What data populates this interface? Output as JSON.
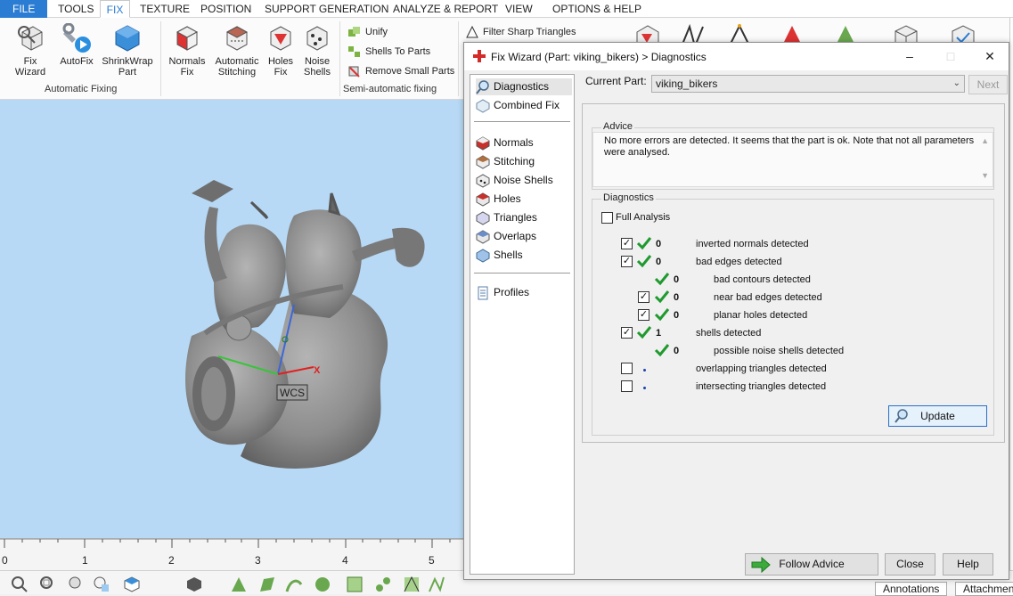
{
  "ribbon_tabs": [
    "FILE",
    "TOOLS",
    "FIX",
    "TEXTURE",
    "POSITION",
    "SUPPORT GENERATION",
    "ANALYZE & REPORT",
    "VIEW",
    "OPTIONS & HELP"
  ],
  "ribbon": {
    "auto_group": {
      "label": "Automatic Fixing",
      "buttons": [
        "Fix Wizard",
        "AutoFix",
        "ShrinkWrap Part"
      ]
    },
    "semi_group": {
      "label": "Semi-automatic fixing",
      "buttons": [
        "Normals Fix",
        "Automatic Stitching",
        "Holes Fix",
        "Noise Shells"
      ],
      "small_buttons": [
        "Unify",
        "Shells To Parts",
        "Remove Small Parts"
      ]
    },
    "filter_label": "Filter Sharp Triangles"
  },
  "viewport": {
    "wcs_label": "WCS",
    "axis_x_label": "X",
    "ruler_ticks": [
      "0",
      "1",
      "2",
      "3",
      "4",
      "5"
    ]
  },
  "bottom_tabs": [
    "Annotations",
    "Attachmen"
  ],
  "dialog": {
    "title": "Fix Wizard (Part: viking_bikers) > Diagnostics",
    "nav": [
      "Diagnostics",
      "Combined Fix",
      "Normals",
      "Stitching",
      "Noise Shells",
      "Holes",
      "Triangles",
      "Overlaps",
      "Shells",
      "Profiles"
    ],
    "current_part_label": "Current Part:",
    "current_part_value": "viking_bikers",
    "next_button": "Next",
    "advice_title": "Advice",
    "advice_text": "No more errors are detected. It seems that the part is ok. Note that not all parameters were analysed.",
    "diagnostics_title": "Diagnostics",
    "full_analysis_label": "Full Analysis",
    "rows": [
      {
        "count": "0",
        "text": "inverted normals detected",
        "checked": true
      },
      {
        "count": "0",
        "text": "bad edges detected",
        "checked": true
      },
      {
        "count": "0",
        "text": "bad contours detected",
        "checked": null
      },
      {
        "count": "0",
        "text": "near bad edges detected",
        "checked": true
      },
      {
        "count": "0",
        "text": "planar holes detected",
        "checked": true
      },
      {
        "count": "1",
        "text": "shells detected",
        "checked": true
      },
      {
        "count": "0",
        "text": "possible noise shells detected",
        "checked": null
      },
      {
        "count": "",
        "text": "overlapping triangles detected",
        "checked": false
      },
      {
        "count": "",
        "text": "intersecting triangles detected",
        "checked": false
      }
    ],
    "update_button": "Update",
    "follow_advice_button": "Follow Advice",
    "close_button": "Close",
    "help_button": "Help"
  },
  "colors": {
    "accent": "#2b7cd3",
    "viewport_bg": "#b7d9f5",
    "check_green": "#1f9a2e",
    "model_gray": "#8d8d8d"
  }
}
